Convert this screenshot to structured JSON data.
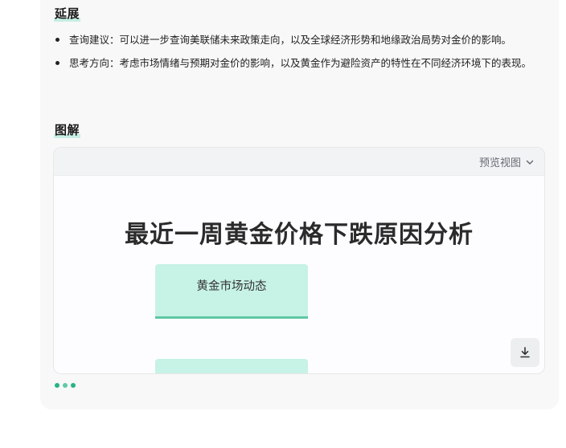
{
  "extension": {
    "heading": "延展",
    "items": [
      {
        "text": "查询建议：可以进一步查询美联储未来政策走向，以及全球经济形势和地缘政治局势对金价的影响。"
      },
      {
        "text": "思考方向：考虑市场情绪与预期对金价的影响，以及黄金作为避险资产的特性在不同经济环境下的表现。"
      }
    ]
  },
  "figure": {
    "heading": "图解",
    "view_toggle_label": "预览视图",
    "diagram_title": "最近一周黄金价格下跌原因分析",
    "nodes": [
      {
        "label": "黄金市场动态"
      },
      {
        "label": "— —"
      }
    ]
  },
  "colors": {
    "accent": "#27b383",
    "node_fill": "#c7f2e6",
    "node_border": "#5fc7a2",
    "heading_highlight": "#c6eee4"
  },
  "icons": {
    "toggle": "chevron-down-icon",
    "download": "download-icon"
  }
}
